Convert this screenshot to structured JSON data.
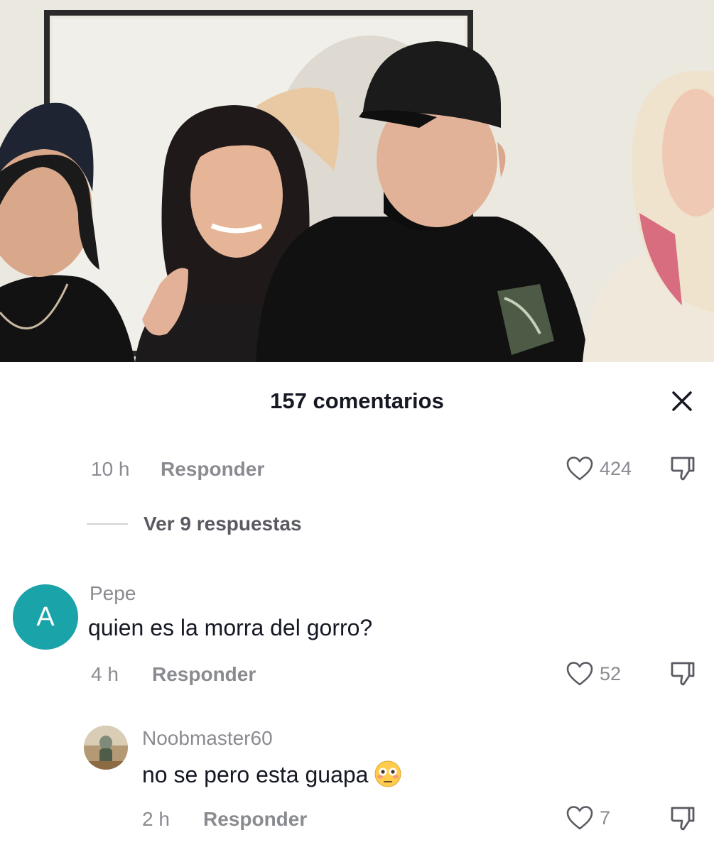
{
  "sheet": {
    "title": "157 comentarios"
  },
  "comments": [
    {
      "time": "10 h",
      "reply_label": "Responder",
      "likes": "424",
      "view_replies": "Ver 9 respuestas"
    },
    {
      "avatar_letter": "A",
      "username": "Pepe",
      "text": "quien es la morra del gorro?",
      "time": "4 h",
      "reply_label": "Responder",
      "likes": "52"
    },
    {
      "username": "Noobmaster60",
      "text": "no se pero esta guapa",
      "emoji": "flushed-face",
      "time": "2 h",
      "reply_label": "Responder",
      "likes": "7"
    }
  ],
  "icons": {
    "close": "close-icon",
    "like": "heart-outline-icon",
    "dislike": "thumb-down-icon"
  },
  "colors": {
    "avatar_teal": "#1aa3a8",
    "secondary_text": "#8a8b91",
    "primary_text": "#161823"
  }
}
